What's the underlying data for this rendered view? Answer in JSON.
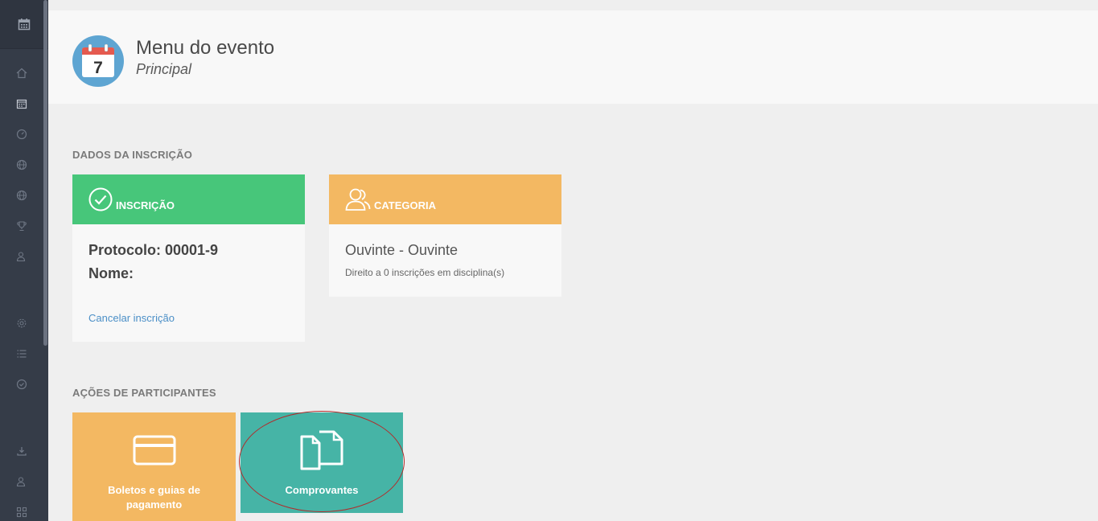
{
  "header": {
    "title": "Menu do evento",
    "subtitle": "Principal",
    "calendar_day": "7"
  },
  "sections": {
    "dados_label": "DADOS DA INSCRIÇÃO",
    "acoes_label": "AÇÕES DE PARTICIPANTES"
  },
  "inscricao": {
    "title": "INSCRIÇÃO",
    "protocolo": "Protocolo: 00001-9",
    "nome": "Nome:",
    "cancel_link": "Cancelar inscrição"
  },
  "categoria": {
    "title": "CATEGORIA",
    "name": "Ouvinte - Ouvinte",
    "description": "Direito a 0 inscrições em disciplina(s)"
  },
  "actions": [
    {
      "label": "Boletos e guias de pagamento",
      "icon": "credit-card-icon"
    },
    {
      "label": "Comprovantes",
      "icon": "documents-icon"
    }
  ],
  "colors": {
    "sidebar": "#353c48",
    "green": "#47c67a",
    "orange": "#f3b862",
    "teal": "#46b4a6",
    "link": "#4b8fc7"
  }
}
